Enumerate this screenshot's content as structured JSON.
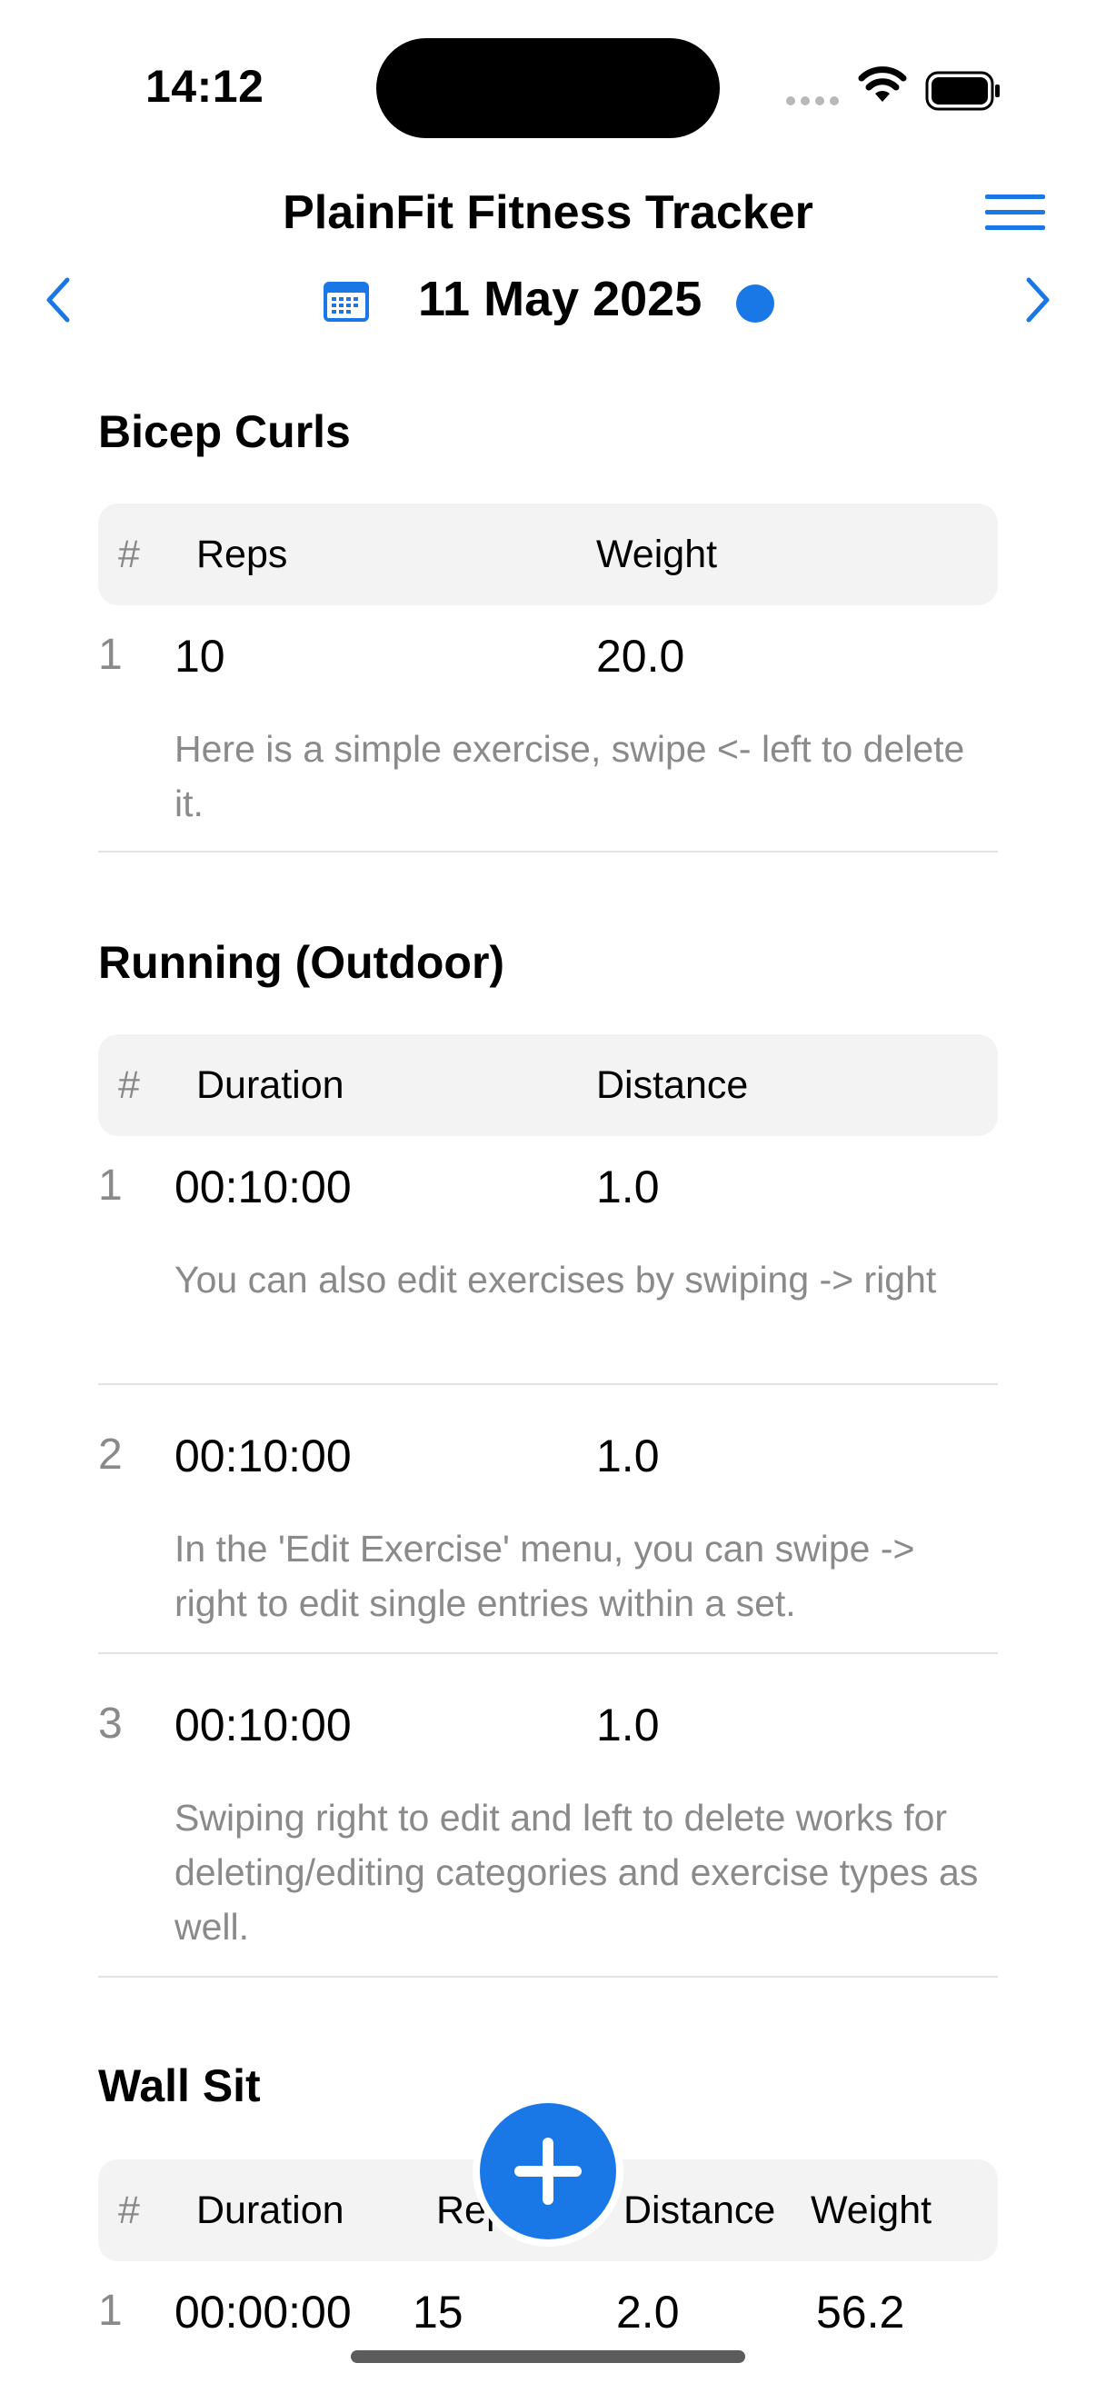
{
  "status": {
    "time": "14:12"
  },
  "app": {
    "title": "PlainFit Fitness Tracker"
  },
  "date_nav": {
    "date": "11 May 2025"
  },
  "sections": [
    {
      "title": "Bicep Curls",
      "headers": [
        "#",
        "Reps",
        "Weight"
      ],
      "rows": [
        {
          "num": "1",
          "c1": "10",
          "c2": "20.0",
          "note": "Here is a simple exercise, swipe <- left to delete it."
        }
      ]
    },
    {
      "title": "Running (Outdoor)",
      "headers": [
        "#",
        "Duration",
        "Distance"
      ],
      "rows": [
        {
          "num": "1",
          "c1": "00:10:00",
          "c2": "1.0",
          "note": "You can also edit exercises by swiping -> right"
        },
        {
          "num": "2",
          "c1": "00:10:00",
          "c2": "1.0",
          "note": "In the 'Edit Exercise' menu, you can swipe -> right to edit single entries within a set."
        },
        {
          "num": "3",
          "c1": "00:10:00",
          "c2": "1.0",
          "note": "Swiping right to edit and left to delete works for deleting/editing categories and exercise types as well."
        }
      ]
    },
    {
      "title": "Wall Sit",
      "headers": [
        "#",
        "Duration",
        "Reps",
        "Distance",
        "Weight"
      ],
      "rows": [
        {
          "num": "1",
          "c1": "00:00:00",
          "c2": "15",
          "c3": "2.0",
          "c4": "56.2"
        }
      ]
    }
  ],
  "colors": {
    "accent": "#1a78e6",
    "header_bg": "#f3f3f3",
    "muted_text": "#8a8a8a"
  },
  "icons": [
    "signal-dots-icon",
    "wifi-icon",
    "battery-icon",
    "hamburger-menu-icon",
    "chevron-left-icon",
    "calendar-icon",
    "chevron-right-icon",
    "plus-icon"
  ]
}
